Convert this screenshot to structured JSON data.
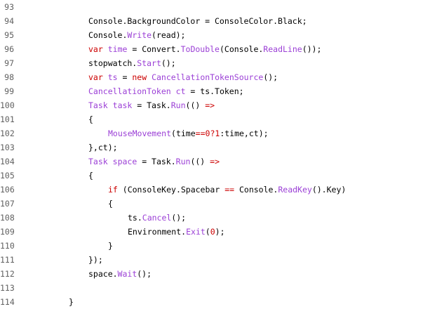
{
  "colors": {
    "plain": "#000000",
    "line_number": "#606060",
    "keyword": "#cc0000",
    "type": "#9b3fd6",
    "method": "#9b3fd6",
    "number": "#cc0000",
    "background": "#ffffff"
  },
  "lines": [
    {
      "number": "93",
      "indent": 0,
      "tokens": []
    },
    {
      "number": "94",
      "indent": 12,
      "tokens": [
        {
          "text": "Console.BackgroundColor = ConsoleColor.Black;",
          "kind": "plain"
        }
      ]
    },
    {
      "number": "95",
      "indent": 12,
      "tokens": [
        {
          "text": "Console.",
          "kind": "plain"
        },
        {
          "text": "Write",
          "kind": "method"
        },
        {
          "text": "(read);",
          "kind": "plain"
        }
      ]
    },
    {
      "number": "96",
      "indent": 12,
      "tokens": [
        {
          "text": "var",
          "kind": "keyword"
        },
        {
          "text": " ",
          "kind": "plain"
        },
        {
          "text": "time",
          "kind": "type"
        },
        {
          "text": " = Convert.",
          "kind": "plain"
        },
        {
          "text": "ToDouble",
          "kind": "method"
        },
        {
          "text": "(Console.",
          "kind": "plain"
        },
        {
          "text": "ReadLine",
          "kind": "method"
        },
        {
          "text": "());",
          "kind": "plain"
        }
      ]
    },
    {
      "number": "97",
      "indent": 12,
      "tokens": [
        {
          "text": "stopwatch.",
          "kind": "plain"
        },
        {
          "text": "Start",
          "kind": "method"
        },
        {
          "text": "();",
          "kind": "plain"
        }
      ]
    },
    {
      "number": "98",
      "indent": 12,
      "tokens": [
        {
          "text": "var",
          "kind": "keyword"
        },
        {
          "text": " ",
          "kind": "plain"
        },
        {
          "text": "ts",
          "kind": "type"
        },
        {
          "text": " = ",
          "kind": "plain"
        },
        {
          "text": "new",
          "kind": "keyword"
        },
        {
          "text": " ",
          "kind": "plain"
        },
        {
          "text": "CancellationTokenSource",
          "kind": "type"
        },
        {
          "text": "();",
          "kind": "plain"
        }
      ]
    },
    {
      "number": "99",
      "indent": 12,
      "tokens": [
        {
          "text": "CancellationToken",
          "kind": "type"
        },
        {
          "text": " ",
          "kind": "plain"
        },
        {
          "text": "ct",
          "kind": "type"
        },
        {
          "text": " = ts.Token;",
          "kind": "plain"
        }
      ]
    },
    {
      "number": "100",
      "indent": 12,
      "tokens": [
        {
          "text": "Task",
          "kind": "type"
        },
        {
          "text": " ",
          "kind": "plain"
        },
        {
          "text": "task",
          "kind": "type"
        },
        {
          "text": " = Task.",
          "kind": "plain"
        },
        {
          "text": "Run",
          "kind": "method"
        },
        {
          "text": "(() ",
          "kind": "plain"
        },
        {
          "text": "=>",
          "kind": "keyword"
        }
      ]
    },
    {
      "number": "101",
      "indent": 12,
      "tokens": [
        {
          "text": "{",
          "kind": "plain"
        }
      ]
    },
    {
      "number": "102",
      "indent": 16,
      "tokens": [
        {
          "text": "MouseMovement",
          "kind": "method"
        },
        {
          "text": "(time",
          "kind": "plain"
        },
        {
          "text": "==",
          "kind": "keyword"
        },
        {
          "text": "0",
          "kind": "number"
        },
        {
          "text": "?",
          "kind": "keyword"
        },
        {
          "text": "1",
          "kind": "number"
        },
        {
          "text": ":time,ct);",
          "kind": "plain"
        }
      ]
    },
    {
      "number": "103",
      "indent": 12,
      "tokens": [
        {
          "text": "},ct);",
          "kind": "plain"
        }
      ]
    },
    {
      "number": "104",
      "indent": 12,
      "tokens": [
        {
          "text": "Task",
          "kind": "type"
        },
        {
          "text": " ",
          "kind": "plain"
        },
        {
          "text": "space",
          "kind": "type"
        },
        {
          "text": " = Task.",
          "kind": "plain"
        },
        {
          "text": "Run",
          "kind": "method"
        },
        {
          "text": "(() ",
          "kind": "plain"
        },
        {
          "text": "=>",
          "kind": "keyword"
        }
      ]
    },
    {
      "number": "105",
      "indent": 12,
      "tokens": [
        {
          "text": "{",
          "kind": "plain"
        }
      ]
    },
    {
      "number": "106",
      "indent": 16,
      "tokens": [
        {
          "text": "if",
          "kind": "keyword"
        },
        {
          "text": " (ConsoleKey.Spacebar ",
          "kind": "plain"
        },
        {
          "text": "==",
          "kind": "keyword"
        },
        {
          "text": " Console.",
          "kind": "plain"
        },
        {
          "text": "ReadKey",
          "kind": "method"
        },
        {
          "text": "().Key)",
          "kind": "plain"
        }
      ]
    },
    {
      "number": "107",
      "indent": 16,
      "tokens": [
        {
          "text": "{",
          "kind": "plain"
        }
      ]
    },
    {
      "number": "108",
      "indent": 20,
      "tokens": [
        {
          "text": "ts.",
          "kind": "plain"
        },
        {
          "text": "Cancel",
          "kind": "method"
        },
        {
          "text": "();",
          "kind": "plain"
        }
      ]
    },
    {
      "number": "109",
      "indent": 20,
      "tokens": [
        {
          "text": "Environment.",
          "kind": "plain"
        },
        {
          "text": "Exit",
          "kind": "method"
        },
        {
          "text": "(",
          "kind": "plain"
        },
        {
          "text": "0",
          "kind": "number"
        },
        {
          "text": ");",
          "kind": "plain"
        }
      ]
    },
    {
      "number": "110",
      "indent": 16,
      "tokens": [
        {
          "text": "}",
          "kind": "plain"
        }
      ]
    },
    {
      "number": "111",
      "indent": 12,
      "tokens": [
        {
          "text": "});",
          "kind": "plain"
        }
      ]
    },
    {
      "number": "112",
      "indent": 12,
      "tokens": [
        {
          "text": "space.",
          "kind": "plain"
        },
        {
          "text": "Wait",
          "kind": "method"
        },
        {
          "text": "();",
          "kind": "plain"
        }
      ]
    },
    {
      "number": "113",
      "indent": 0,
      "tokens": []
    },
    {
      "number": "114",
      "indent": 8,
      "tokens": [
        {
          "text": "}",
          "kind": "plain"
        }
      ]
    }
  ]
}
